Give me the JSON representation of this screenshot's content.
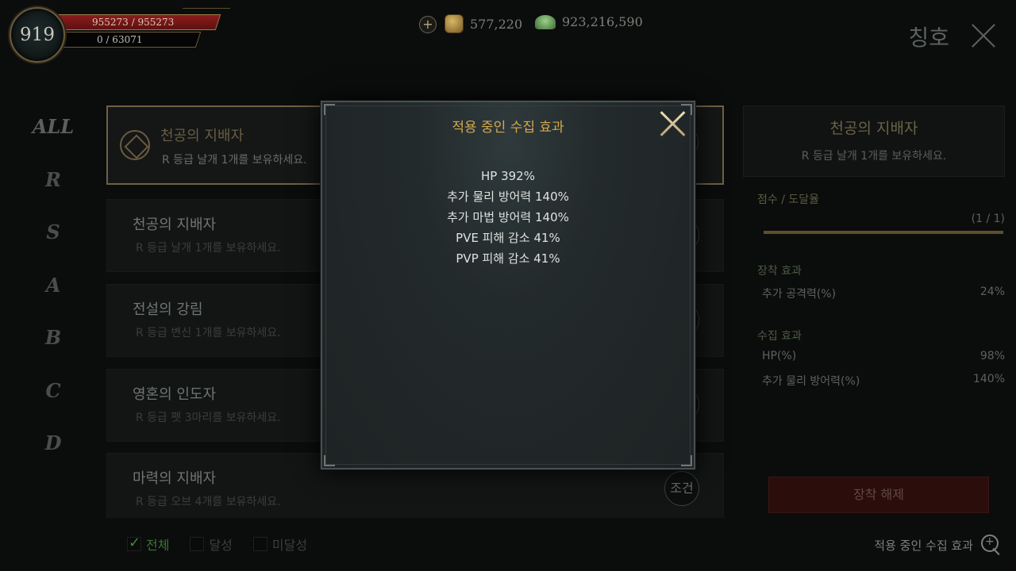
{
  "hud": {
    "level": "919",
    "hp_text": "955273 / 955273",
    "exp_text": "0 / 63071",
    "currency_add_label": "+",
    "gold_amount": "577,220",
    "gem_amount": "923,216,590"
  },
  "page": {
    "title": "칭호"
  },
  "grades": [
    "ALL",
    "R",
    "S",
    "A",
    "B",
    "C",
    "D"
  ],
  "list": {
    "items": [
      {
        "name": "천공의 지배자",
        "desc": "R 등급 날개 1개를 보유하세요.",
        "selected": true
      },
      {
        "name": "천공의 지배자",
        "desc": "R 등급 날개 1개를 보유하세요.",
        "selected": false
      },
      {
        "name": "전설의 강림",
        "desc": "R 등급 변신 1개를 보유하세요.",
        "selected": false
      },
      {
        "name": "영혼의 인도자",
        "desc": "R 등급 펫 3마리를 보유하세요.",
        "selected": false
      },
      {
        "name": "마력의 지배자",
        "desc": "R 등급 오브 4개를 보유하세요.",
        "selected": false
      }
    ],
    "condition_label": "조건"
  },
  "filters": [
    {
      "label": "전체",
      "checked": true
    },
    {
      "label": "달성",
      "checked": false
    },
    {
      "label": "미달성",
      "checked": false
    }
  ],
  "detail": {
    "title": "천공의 지배자",
    "desc": "R 등급 날개 1개를 보유하세요.",
    "progress_label": "점수 / 도달율",
    "progress_value": "(1 / 1)",
    "progress_fraction": 1.0,
    "equip_effect_label": "장착 효과",
    "equip_effects": [
      {
        "name": "추가 공격력(%)",
        "value": "24%"
      }
    ],
    "collect_effect_label": "수집 효과",
    "collect_effects": [
      {
        "name": "HP(%)",
        "value": "98%"
      },
      {
        "name": "추가 물리 방어력(%)",
        "value": "140%"
      }
    ],
    "unequip_label": "장착 해제"
  },
  "effects_link": {
    "label": "적용 중인 수집 효과",
    "icon": "zoom-in-icon"
  },
  "modal": {
    "title": "적용 중인 수집 효과",
    "effects": [
      "HP 392%",
      "추가 물리 방어력 140%",
      "추가 마법 방어력 140%",
      "PVE 피해 감소 41%",
      "PVP 피해 감소 41%"
    ]
  },
  "colors": {
    "accent_gold": "#d1a84f",
    "hp_red": "#8c1c1c",
    "check_green": "#3c8e3a"
  }
}
